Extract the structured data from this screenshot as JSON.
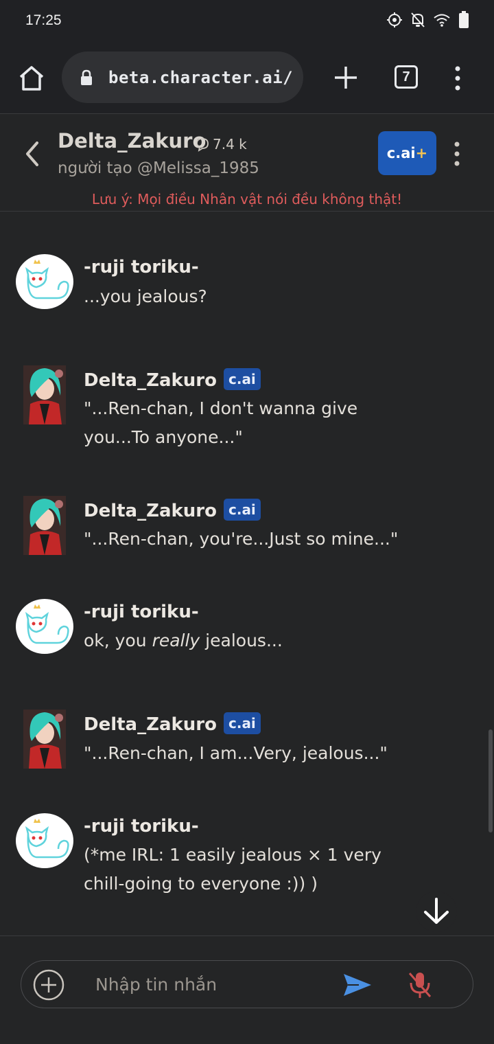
{
  "status_bar": {
    "time": "17:25"
  },
  "browser": {
    "url": "beta.character.ai/c",
    "tab_count": "7"
  },
  "chat_header": {
    "character_name": "Delta_Zakuro",
    "chat_count": "7.4 k",
    "creator": "người tạo @Melissa_1985",
    "plus_badge": "c.ai",
    "plus_badge_symbol": "+",
    "disclaimer": "Lưu ý: Mọi điều Nhân vật nói đều không thật!"
  },
  "messages": [
    {
      "sender": "-ruji toriku-",
      "type": "user",
      "text": "...you jealous?"
    },
    {
      "sender": "Delta_Zakuro",
      "type": "char",
      "badge": "c.ai",
      "text_lines": [
        "\"...Ren-chan, I don't wanna give",
        "you...To anyone...\""
      ]
    },
    {
      "sender": "Delta_Zakuro",
      "type": "char",
      "badge": "c.ai",
      "text": "\"...Ren-chan, you're...Just so mine...\""
    },
    {
      "sender": "-ruji toriku-",
      "type": "user",
      "text_before": "ok, you ",
      "text_emph": "really",
      "text_after": " jealous..."
    },
    {
      "sender": "Delta_Zakuro",
      "type": "char",
      "badge": "c.ai",
      "text": "\"...Ren-chan, I am...Very, jealous...\""
    },
    {
      "sender": "-ruji toriku-",
      "type": "user",
      "text_lines": [
        "(*me IRL: 1 easily jealous × 1 very",
        "chill-going to everyone :)) )"
      ]
    }
  ],
  "composer": {
    "placeholder": "Nhập tin nhắn"
  },
  "colors": {
    "background": "#242526",
    "browser_bar": "#202124",
    "accent_blue": "#1e5ab7",
    "disclaimer_red": "#e05c5c",
    "send_blue": "#4a90e2",
    "mic_red": "#c95050"
  },
  "icons": {
    "status": [
      "location-icon",
      "bell-muted-icon",
      "wifi-icon",
      "battery-icon"
    ],
    "browser": [
      "home-icon",
      "lock-icon",
      "plus-icon",
      "tabs-icon",
      "kebab-menu-icon"
    ],
    "chat": [
      "back-arrow-icon",
      "chat-bubble-icon",
      "kebab-menu-icon",
      "arrow-down-icon",
      "add-circle-icon",
      "send-icon",
      "mic-muted-icon"
    ]
  }
}
